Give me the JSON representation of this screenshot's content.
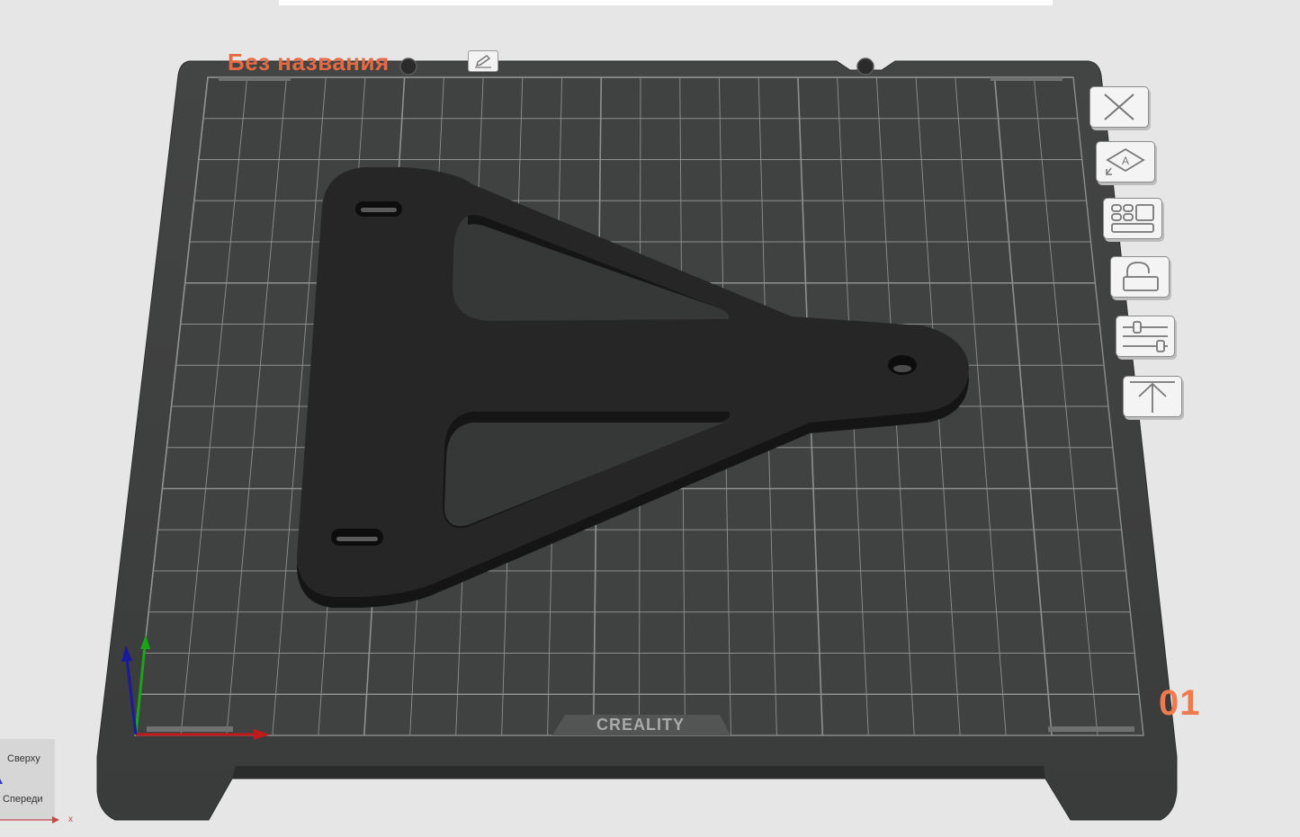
{
  "plate": {
    "title": "Без названия",
    "number": "01",
    "brand": "CREALITY"
  },
  "toolbar": {
    "buttons": [
      {
        "name": "delete-plate",
        "icon": "close-x-icon"
      },
      {
        "name": "auto-orient",
        "icon": "orient-a-icon"
      },
      {
        "name": "arrange",
        "icon": "arrange-layout-icon"
      },
      {
        "name": "lock-plate",
        "icon": "lock-icon"
      },
      {
        "name": "plate-settings",
        "icon": "sliders-icon"
      },
      {
        "name": "move-to-top",
        "icon": "arrow-up-to-line-icon"
      }
    ]
  },
  "view_cube": {
    "top_label": "Сверху",
    "front_label": "Спереди",
    "x_axis_label": "x"
  },
  "colors": {
    "accent": "#e56a44",
    "plate": "#3e3f3f",
    "grid_line": "#8e9090",
    "model": "#222222",
    "background": "#e6e6e6",
    "axis_x": "#c01b1b",
    "axis_y": "#1aa41a",
    "axis_z": "#1a1a9e"
  }
}
